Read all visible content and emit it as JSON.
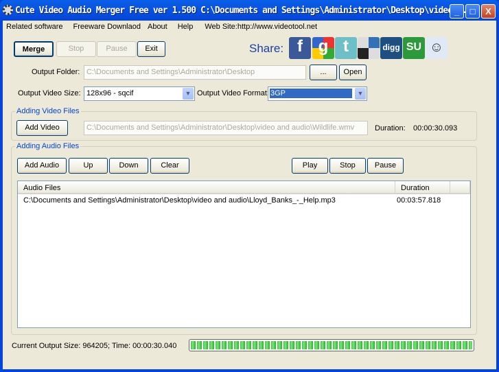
{
  "window": {
    "title": "Cute Video Audio Merger Free  ver 1.500  C:\\Documents and Settings\\Administrator\\Desktop\\video..."
  },
  "menu": [
    "Related software",
    "Freeware Downlaod",
    "About",
    "Help",
    "Web Site:http://www.videotool.net"
  ],
  "toolbar": {
    "merge": "Merge",
    "stop": "Stop",
    "pause": "Pause",
    "exit": "Exit"
  },
  "share": {
    "label": "Share:",
    "icons": [
      "facebook",
      "google",
      "twitter",
      "delicious",
      "digg",
      "stumbleupon",
      "reddit"
    ],
    "digg_text": "digg",
    "su_text": "SU"
  },
  "output": {
    "folder_label": "Output Folder:",
    "folder_value": "C:\\Documents and Settings\\Administrator\\Desktop",
    "browse": "...",
    "open": "Open",
    "size_label": "Output Video Size:",
    "size_value": "128x96 - sqcif",
    "format_label": "Output Video Format:",
    "format_value": "3GP"
  },
  "video": {
    "group": "Adding Video Files",
    "add": "Add Video",
    "path": "C:\\Documents and Settings\\Administrator\\Desktop\\video and audio\\Wildlife.wmv",
    "duration_label": "Duration:",
    "duration": "00:00:30.093"
  },
  "audio": {
    "group": "Adding Audio Files",
    "add": "Add Audio",
    "up": "Up",
    "down": "Down",
    "clear": "Clear",
    "play": "Play",
    "stop": "Stop",
    "pause": "Pause",
    "col_files": "Audio Files",
    "col_duration": "Duration",
    "rows": [
      {
        "file": "C:\\Documents and Settings\\Administrator\\Desktop\\video and audio\\Lloyd_Banks_-_Help.mp3",
        "duration": "00:03:57.818"
      }
    ]
  },
  "status": {
    "text": "Current Output Size: 964205; Time: 00:00:30.040",
    "progress_percent": 100
  }
}
